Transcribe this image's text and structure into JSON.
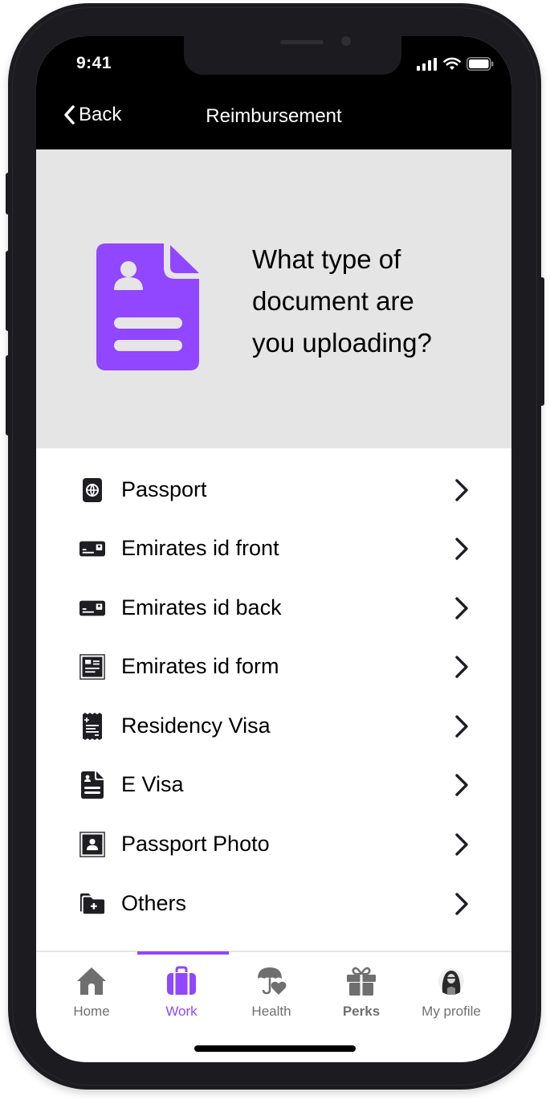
{
  "status_bar": {
    "time": "9:41"
  },
  "nav": {
    "back_label": "Back",
    "title": "Reimbursement"
  },
  "hero": {
    "line1": "What type of",
    "line2": "document are",
    "line3": "you uploading?",
    "accent_color": "#9146ff"
  },
  "documents": [
    {
      "label": "Passport",
      "icon": "passport-icon"
    },
    {
      "label": "Emirates id front",
      "icon": "id-card-icon"
    },
    {
      "label": "Emirates id back",
      "icon": "id-card-icon"
    },
    {
      "label": "Emirates id form",
      "icon": "form-icon"
    },
    {
      "label": "Residency Visa",
      "icon": "receipt-icon"
    },
    {
      "label": "E Visa",
      "icon": "document-person-icon"
    },
    {
      "label": "Passport Photo",
      "icon": "portrait-icon"
    },
    {
      "label": "Others",
      "icon": "folder-plus-icon"
    }
  ],
  "tabbar": {
    "active": "Work",
    "active_color": "#9146ff",
    "items": [
      {
        "label": "Home",
        "icon": "home-icon"
      },
      {
        "label": "Work",
        "icon": "briefcase-icon"
      },
      {
        "label": "Health",
        "icon": "umbrella-heart-icon"
      },
      {
        "label": "Perks",
        "icon": "gift-icon"
      },
      {
        "label": "My profile",
        "icon": "avatar-icon"
      }
    ]
  }
}
